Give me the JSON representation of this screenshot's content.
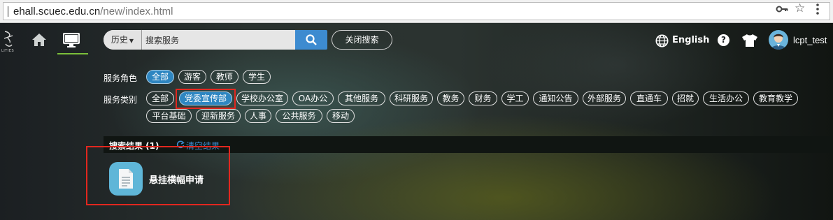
{
  "browser": {
    "url_host": "ehall.scuec.edu.cn",
    "url_path": "/new/index.html"
  },
  "nav": {
    "logo_text": "LITIES",
    "history_label": "历史",
    "search_value": "搜索服务",
    "close_search_label": "关闭搜索",
    "language_label": "English",
    "help_label": "?",
    "username": "lcpt_test"
  },
  "filters": {
    "role_label": "服务角色",
    "roles": [
      "全部",
      "游客",
      "教师",
      "学生"
    ],
    "category_label": "服务类别",
    "categories_row1": [
      "全部",
      "党委宣传部",
      "学校办公室",
      "OA办公",
      "其他服务",
      "科研服务",
      "教务",
      "财务",
      "学工",
      "通知公告",
      "外部服务",
      "直通车",
      "招就",
      "生活办公",
      "教育教学"
    ],
    "categories_row2": [
      "平台基础",
      "迎新服务",
      "人事",
      "公共服务",
      "移动"
    ]
  },
  "results": {
    "header": "搜索结果 (1)",
    "clear_label": "清空结果",
    "items": [
      {
        "name": "悬挂横幅申请",
        "icon": "document-icon"
      }
    ]
  },
  "colors": {
    "accent": "#2e86c1",
    "search_button": "#3d8bd0",
    "highlight_box": "#e2271f",
    "active_nav": "#7bbf3a"
  }
}
